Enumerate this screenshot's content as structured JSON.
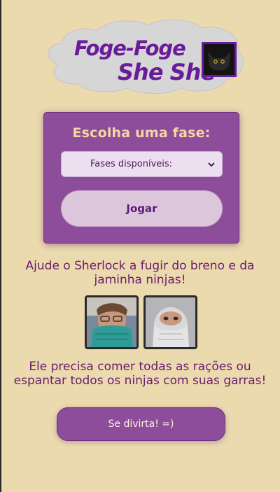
{
  "logo": {
    "line1": "Foge-Foge",
    "line2": "She She"
  },
  "phase": {
    "title": "Escolha uma fase:",
    "select_value": "Fases disponíveis:",
    "play_label": "Jogar"
  },
  "help_text": "Ajude o Sherlock a fugir do breno e da jaminha ninjas!",
  "goal_text": "Ele precisa comer todas as rações ou espantar todos os ninjas com suas garras!",
  "fun_button_label": "Se divirta! =)",
  "colors": {
    "background": "#ecdaaf",
    "purple": "#8e4d9b",
    "logo_text": "#6a1b9a",
    "phase_title": "#f3d6a4"
  }
}
